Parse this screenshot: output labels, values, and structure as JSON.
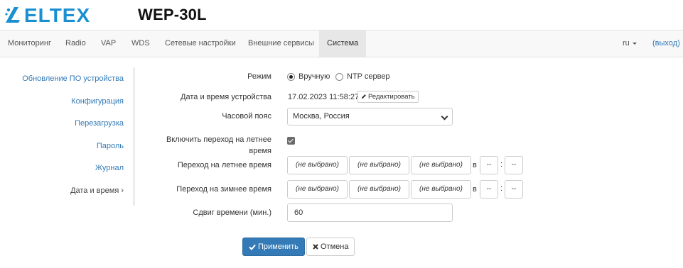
{
  "header": {
    "logo_text": "ELTEX",
    "model": "WEP-30L"
  },
  "nav": {
    "items": [
      "Мониторинг",
      "Radio",
      "VAP",
      "WDS",
      "Сетевые настройки",
      "Внешние сервисы",
      "Система"
    ],
    "active": "Система",
    "language": "ru",
    "logout": "(выход)"
  },
  "sidebar": {
    "items": [
      "Обновление ПО устройства",
      "Конфигурация",
      "Перезагрузка",
      "Пароль",
      "Журнал",
      "Дата и время ›"
    ],
    "active": "Дата и время ›"
  },
  "form": {
    "mode": {
      "label": "Режим",
      "option_manual": "Вручную",
      "option_ntp": "NTP сервер",
      "selected": "Вручную"
    },
    "datetime": {
      "label": "Дата и время устройства",
      "value": "17.02.2023 11:58:27",
      "edit_button": "Редактировать"
    },
    "timezone": {
      "label": "Часовой пояс",
      "value": "Москва, Россия"
    },
    "dst_enable": {
      "label": "Включить переход на летнее время",
      "checked": true
    },
    "dst_start": {
      "label": "Переход на летнее время",
      "selects": [
        "(не выбрано)",
        "(не выбрано)",
        "(не выбрано)"
      ],
      "at_word": "в",
      "hour": "--",
      "sep": ":",
      "minute": "--"
    },
    "dst_end": {
      "label": "Переход на зимнее время",
      "selects": [
        "(не выбрано)",
        "(не выбрано)",
        "(не выбрано)"
      ],
      "at_word": "в",
      "hour": "--",
      "sep": ":",
      "minute": "--"
    },
    "offset": {
      "label": "Сдвиг времени (мин.)",
      "value": "60"
    }
  },
  "actions": {
    "apply": "Применить",
    "cancel": "Отмена"
  },
  "colors": {
    "brand": "#1a8fd1",
    "link": "#337ab7",
    "primary_button": "#337ab7"
  }
}
